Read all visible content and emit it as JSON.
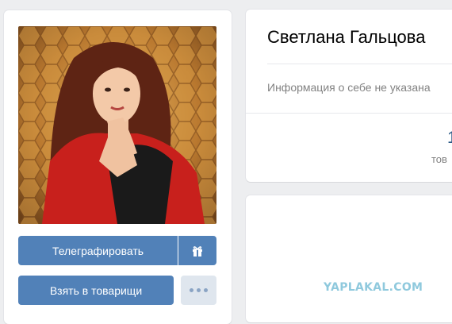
{
  "profile": {
    "name": "Светлана Гальцова",
    "about": "Информация о себе не указана",
    "counter": {
      "value": "1",
      "label": "тов"
    }
  },
  "actions": {
    "message_label": "Телеграфировать",
    "add_friend_label": "Взять в товарищи",
    "gift_icon": "gift-icon",
    "more_icon": "more-dots-icon"
  },
  "watermark": "YAPLAKAL.COM",
  "colors": {
    "accent": "#5181b8",
    "page_background": "#edeef0",
    "secondary_button": "#dfe6ee",
    "muted_text": "#828282",
    "link_blue": "#2a5885",
    "watermark": "#8fc9dd"
  }
}
